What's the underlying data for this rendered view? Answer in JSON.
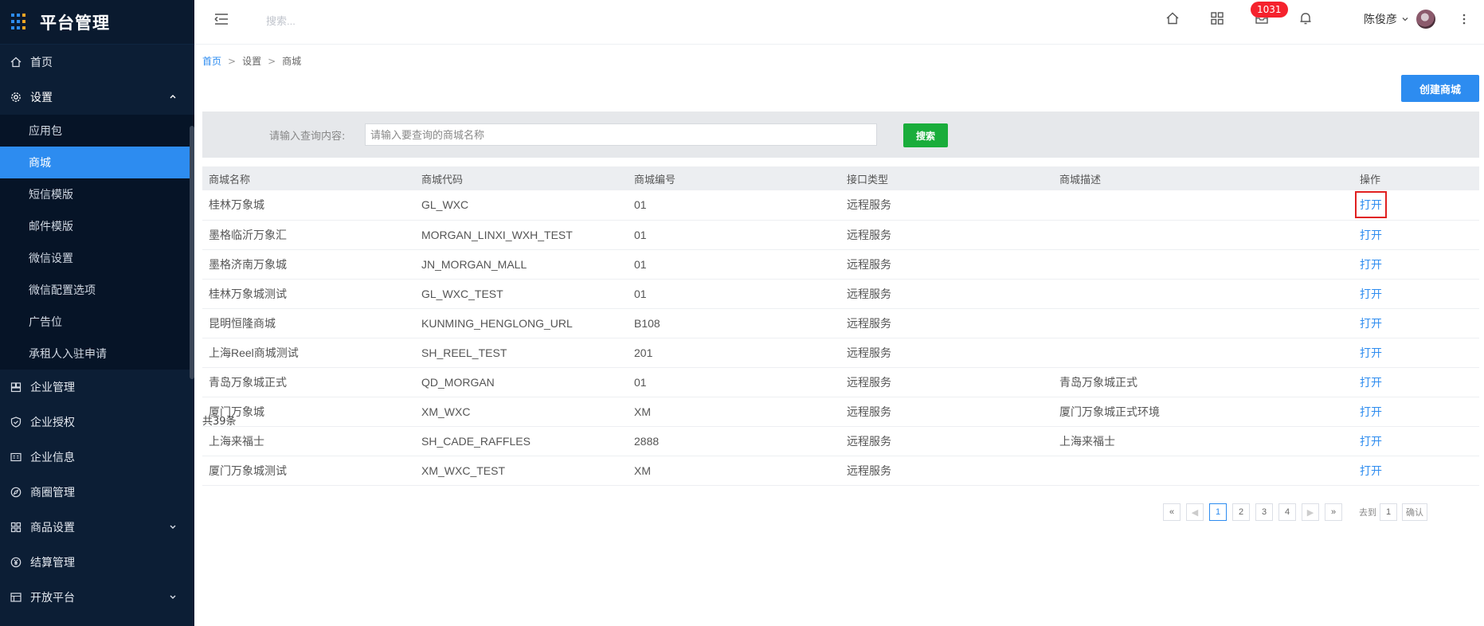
{
  "app": {
    "title": "平台管理"
  },
  "colors": {
    "accent": "#2d8cf0",
    "sidebar_bg": "#0c1e35",
    "search_button": "#1aad3b",
    "badge": "#f5222d"
  },
  "sidebar": {
    "items": [
      {
        "label": "首页",
        "icon": "home-icon"
      },
      {
        "label": "设置",
        "icon": "gear-icon",
        "expanded": true,
        "children": [
          "应用包",
          "商城",
          "短信模版",
          "邮件模版",
          "微信设置",
          "微信配置选项",
          "广告位",
          "承租人入驻申请"
        ],
        "active_child": "商城"
      },
      {
        "label": "企业管理",
        "icon": "enterprise-icon"
      },
      {
        "label": "企业授权",
        "icon": "shield-check-icon"
      },
      {
        "label": "企业信息",
        "icon": "id-card-icon"
      },
      {
        "label": "商圈管理",
        "icon": "compass-icon"
      },
      {
        "label": "商品设置",
        "icon": "grid-icon",
        "has_children": true
      },
      {
        "label": "结算管理",
        "icon": "yen-icon"
      },
      {
        "label": "开放平台",
        "icon": "list-icon",
        "has_children": true
      }
    ]
  },
  "topbar": {
    "search_placeholder": "搜索...",
    "badge_count": "1031",
    "user_name": "陈俊彦"
  },
  "breadcrumb": {
    "home": "首页",
    "sep": ">",
    "level1": "设置",
    "level2": "商城"
  },
  "actions": {
    "create_label": "创建商城"
  },
  "search": {
    "label": "请输入查询内容:",
    "placeholder": "请输入要查询的商城名称",
    "button_label": "搜索"
  },
  "table": {
    "headers": [
      "商城名称",
      "商城代码",
      "商城编号",
      "接口类型",
      "商城描述",
      "操作"
    ],
    "rows": [
      {
        "name": "桂林万象城",
        "code": "GL_WXC",
        "number": "01",
        "type": "远程服务",
        "desc": "",
        "action": "打开"
      },
      {
        "name": "墨格临沂万象汇",
        "code": "MORGAN_LINXI_WXH_TEST",
        "number": "01",
        "type": "远程服务",
        "desc": "",
        "action": "打开"
      },
      {
        "name": "墨格济南万象城",
        "code": "JN_MORGAN_MALL",
        "number": "01",
        "type": "远程服务",
        "desc": "",
        "action": "打开"
      },
      {
        "name": "桂林万象城测试",
        "code": "GL_WXC_TEST",
        "number": "01",
        "type": "远程服务",
        "desc": "",
        "action": "打开"
      },
      {
        "name": "昆明恒隆商城",
        "code": "KUNMING_HENGLONG_URL",
        "number": "B108",
        "type": "远程服务",
        "desc": "",
        "action": "打开"
      },
      {
        "name": "上海Reel商城测试",
        "code": "SH_REEL_TEST",
        "number": "201",
        "type": "远程服务",
        "desc": "",
        "action": "打开"
      },
      {
        "name": "青岛万象城正式",
        "code": "QD_MORGAN",
        "number": "01",
        "type": "远程服务",
        "desc": "青岛万象城正式",
        "action": "打开"
      },
      {
        "name": "厦门万象城",
        "code": "XM_WXC",
        "number": "XM",
        "type": "远程服务",
        "desc": "厦门万象城正式环境",
        "action": "打开"
      },
      {
        "name": "上海来福士",
        "code": "SH_CADE_RAFFLES",
        "number": "2888",
        "type": "远程服务",
        "desc": "上海来福士",
        "action": "打开"
      },
      {
        "name": "厦门万象城测试",
        "code": "XM_WXC_TEST",
        "number": "XM",
        "type": "远程服务",
        "desc": "",
        "action": "打开"
      }
    ],
    "total": "共39条"
  },
  "pagination": {
    "first": "«",
    "prev": "◀",
    "pages": [
      "1",
      "2",
      "3",
      "4"
    ],
    "current": "1",
    "next": "▶",
    "last": "»",
    "goto_label": "去到",
    "goto_value": "1",
    "confirm": "确认"
  }
}
